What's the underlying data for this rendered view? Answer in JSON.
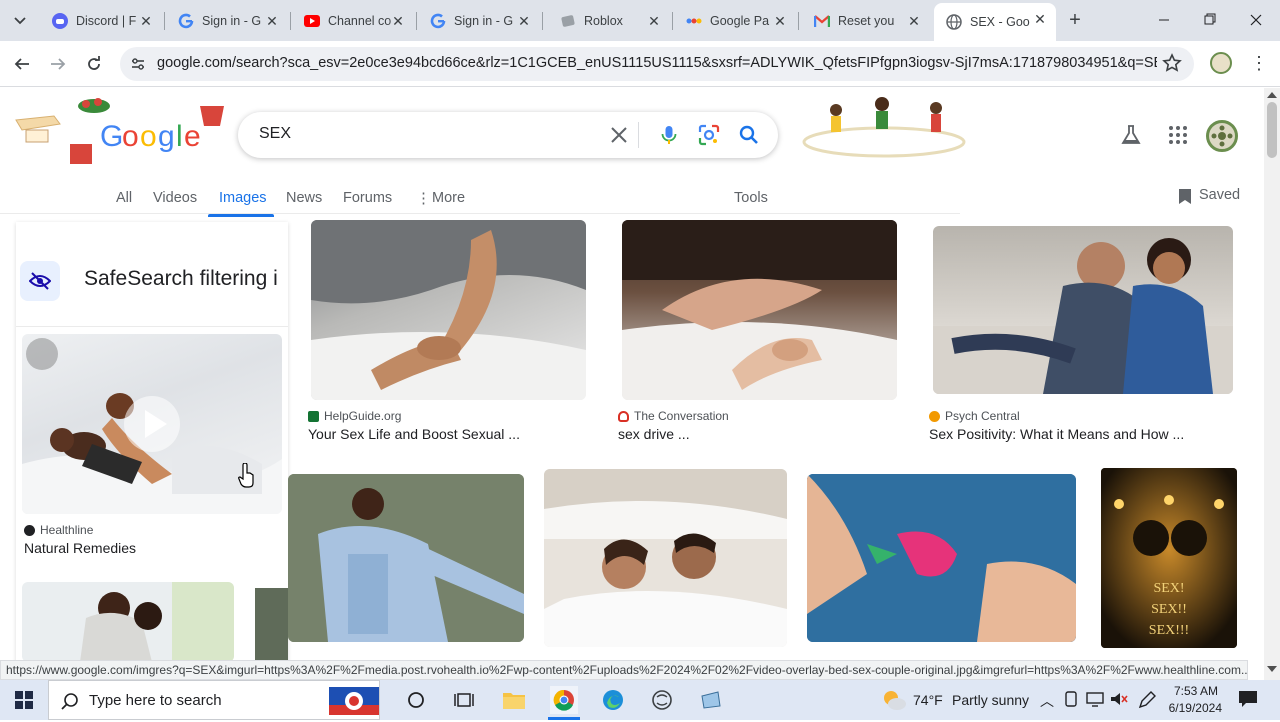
{
  "tabs": [
    {
      "label": "Discord | F",
      "icon": "discord-icon"
    },
    {
      "label": "Sign in - G",
      "icon": "google-icon"
    },
    {
      "label": "Channel co",
      "icon": "youtube-icon"
    },
    {
      "label": "Sign in - G",
      "icon": "google-icon"
    },
    {
      "label": "Roblox",
      "icon": "roblox-icon"
    },
    {
      "label": "Google Pa",
      "icon": "google-pay-icon"
    },
    {
      "label": "Reset you",
      "icon": "gmail-icon"
    },
    {
      "label": "SEX - Goo",
      "icon": "globe-icon"
    }
  ],
  "address": {
    "url": "google.com/search?sca_esv=2e0ce3e94bcd66ce&rlz=1C1GCEB_enUS1115US1115&sxsrf=ADLYWIK_QfetsFIPfgpn3iogsv-SjI7msA:1718798034951&q=SEX&udm..."
  },
  "search": {
    "query": "SEX"
  },
  "nav_tabs": [
    {
      "label": "All"
    },
    {
      "label": "Videos"
    },
    {
      "label": "Images"
    },
    {
      "label": "News"
    },
    {
      "label": "Forums"
    },
    {
      "label": "More"
    }
  ],
  "tools_label": "Tools",
  "saved_label": "Saved",
  "safesearch_text": "SafeSearch filtering i",
  "results": [
    {
      "source": "HelpGuide.org",
      "title": "Your Sex Life and Boost Sexual ...",
      "fav_color": "#137333"
    },
    {
      "source": "The Conversation",
      "title": "sex drive ...",
      "fav_color": "#d93025"
    },
    {
      "source": "Psych Central",
      "title": "Sex Positivity: What it Means and How ...",
      "fav_color": "#f29900"
    },
    {
      "source": "Healthline",
      "title": "Natural Remedies",
      "fav_color": "#202124"
    }
  ],
  "poster_text": [
    "SEX!",
    "SEX!!",
    "SEX!!!"
  ],
  "status_url": "https://www.google.com/imgres?q=SEX&imgurl=https%3A%2F%2Fmedia.post.rvohealth.io%2Fwp-content%2Fuploads%2F2024%2F02%2Fvideo-overlay-bed-sex-couple-original.jpg&imgrefurl=https%3A%2F%2Fwww.healthline.com...",
  "taskbar": {
    "search_placeholder": "Type here to search",
    "weather_temp": "74°F",
    "weather_desc": "Partly sunny",
    "time": "7:53 AM",
    "date": "6/19/2024"
  }
}
